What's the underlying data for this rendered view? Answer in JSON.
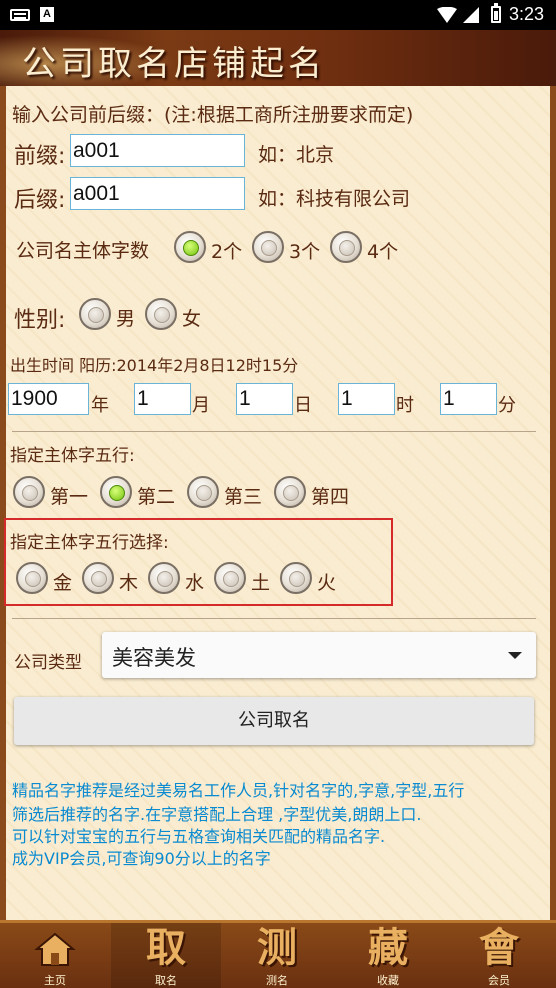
{
  "status_bar": {
    "time": "3:23",
    "notification_badge": "A"
  },
  "header": {
    "title": "公司取名店铺起名"
  },
  "form": {
    "intro": "输入公司前后缀：(注:根据工商所注册要求而定)",
    "prefix": {
      "label": "前缀:",
      "value": "a001",
      "example": "如：北京"
    },
    "suffix": {
      "label": "后缀:",
      "value": "a001",
      "example": "如：科技有限公司"
    },
    "char_count": {
      "label": "公司名主体字数",
      "options": [
        "2个",
        "3个",
        "4个"
      ],
      "selected": "2个"
    },
    "gender": {
      "label": "性别:",
      "options": [
        "男",
        "女"
      ]
    },
    "birth": {
      "label": "出生时间 阳历:2014年2月8日12时15分",
      "fields": [
        {
          "value": "1900",
          "unit": "年"
        },
        {
          "value": "1",
          "unit": "月"
        },
        {
          "value": "1",
          "unit": "日"
        },
        {
          "value": "1",
          "unit": "时"
        },
        {
          "value": "1",
          "unit": "分"
        }
      ]
    },
    "position": {
      "label": "指定主体字五行:",
      "options": [
        "第一",
        "第二",
        "第三",
        "第四"
      ],
      "selected": "第二"
    },
    "element": {
      "label": "指定主体字五行选择:",
      "options": [
        "金",
        "木",
        "水",
        "土",
        "火"
      ]
    },
    "company_type": {
      "label": "公司类型",
      "value": "美容美发"
    },
    "submit_label": "公司取名"
  },
  "description": [
    "精品名字推荐是经过美易名工作人员,针对名字的,字意,字型,五行",
    "筛选后推荐的名字.在字意搭配上合理 ,字型优美,朗朗上口.",
    "可以针对宝宝的五行与五格查询相关匹配的精品名字.",
    "成为VIP会员,可查询90分以上的名字"
  ],
  "bottom_nav": [
    {
      "glyph": "",
      "label": "主页",
      "icon": "home-icon"
    },
    {
      "glyph": "取",
      "label": "取名",
      "active": true
    },
    {
      "glyph": "测",
      "label": "测名"
    },
    {
      "glyph": "藏",
      "label": "收藏"
    },
    {
      "glyph": "會",
      "label": "会员"
    }
  ],
  "colors": {
    "accent_link": "#0a8ad0",
    "highlight_border": "#d42a2a",
    "radio_checked": "#74c20e",
    "title_bar": "#6e2e10"
  }
}
